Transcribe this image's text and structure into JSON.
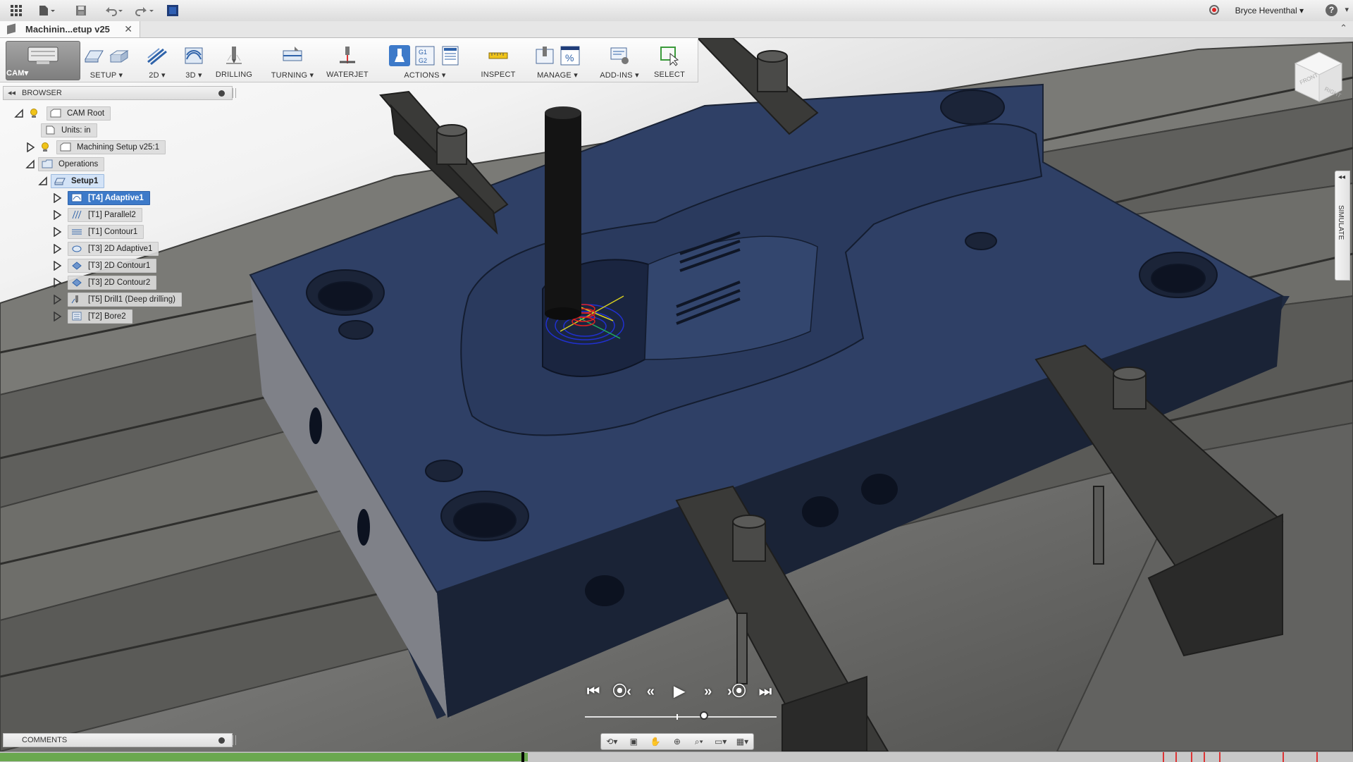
{
  "app_bar": {
    "icons": [
      "app-grid-icon",
      "file-icon",
      "save-icon",
      "undo-icon",
      "redo-icon",
      "job-status-icon"
    ],
    "user_name": "Bryce Heventhal",
    "help": "?"
  },
  "document_tab": {
    "title": "Machinin...etup v25",
    "close": "✕"
  },
  "toolbar": {
    "workspace": "CAM",
    "groups": [
      {
        "name": "setup",
        "label": "SETUP",
        "dropdown": true
      },
      {
        "name": "2d",
        "label": "2D",
        "dropdown": true
      },
      {
        "name": "3d",
        "label": "3D",
        "dropdown": true
      },
      {
        "name": "drilling",
        "label": "DRILLING",
        "dropdown": false
      },
      {
        "name": "turning",
        "label": "TURNING",
        "dropdown": true
      },
      {
        "name": "waterjet",
        "label": "WATERJET",
        "dropdown": false
      },
      {
        "name": "actions",
        "label": "ACTIONS",
        "dropdown": true
      },
      {
        "name": "inspect",
        "label": "INSPECT",
        "dropdown": false
      },
      {
        "name": "manage",
        "label": "MANAGE",
        "dropdown": true
      },
      {
        "name": "add-ins",
        "label": "ADD-INS",
        "dropdown": true
      },
      {
        "name": "select",
        "label": "SELECT",
        "dropdown": false
      }
    ],
    "actions_icon_text": "G1\nG2",
    "manage_icon_text": "%"
  },
  "browser": {
    "title": "BROWSER",
    "root": "CAM Root",
    "units": "Units: in",
    "setup_model": "Machining Setup v25:1",
    "operations": "Operations",
    "setup": "Setup1",
    "ops": [
      {
        "label": "[T4] Adaptive1",
        "selected": true
      },
      {
        "label": "[T1] Parallel2",
        "selected": false
      },
      {
        "label": "[T1] Contour1",
        "selected": false
      },
      {
        "label": "[T3] 2D Adaptive1",
        "selected": false
      },
      {
        "label": "[T3] 2D Contour1",
        "selected": false
      },
      {
        "label": "[T3] 2D Contour2",
        "selected": false
      },
      {
        "label": "[T5] Drill1 (Deep drilling)",
        "selected": false
      },
      {
        "label": "[T2] Bore2",
        "selected": false
      }
    ]
  },
  "simulate_tab": "SIMULATE",
  "view_cube": {
    "front": "FRONT",
    "right": "RIGHT"
  },
  "playback": {
    "buttons": [
      "⏮",
      "⦿‹",
      "«",
      "▶",
      "»",
      "›⦿",
      "⏭"
    ],
    "position": 0.62
  },
  "comments": {
    "title": "COMMENTS"
  },
  "timeline": {
    "progress": 0.39
  },
  "colors": {
    "stock": "#2e3f63",
    "selection": "#3d7ac9",
    "clamp": "#3a3a38",
    "toolpath_red": "#e02020",
    "toolpath_blue": "#2030d0"
  }
}
